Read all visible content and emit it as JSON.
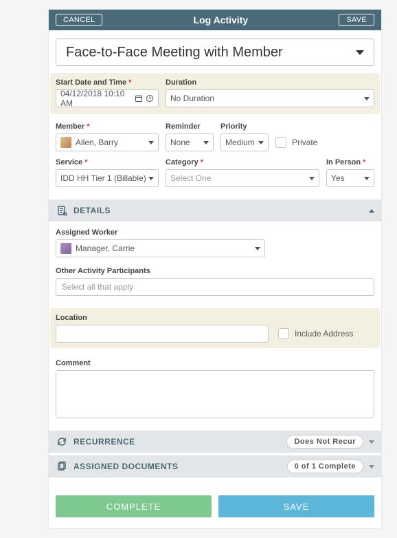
{
  "header": {
    "cancel_label": "CANCEL",
    "title": "Log Activity",
    "save_label": "SAVE"
  },
  "activity_type": {
    "value": "Face-to-Face Meeting with Member"
  },
  "fields": {
    "start": {
      "label": "Start Date and Time",
      "value": "04/12/2018  10:10 AM"
    },
    "duration": {
      "label": "Duration",
      "value": "No Duration"
    },
    "member": {
      "label": "Member",
      "value": "Allen, Barry"
    },
    "reminder": {
      "label": "Reminder",
      "value": "None"
    },
    "priority": {
      "label": "Priority",
      "value": "Medium"
    },
    "private": {
      "label": "Private"
    },
    "service": {
      "label": "Service",
      "value": "IDD HH Tier 1 (Billable)"
    },
    "category": {
      "label": "Category",
      "value": "Select One"
    },
    "inperson": {
      "label": "In Person",
      "value": "Yes"
    }
  },
  "details": {
    "title": "DETAILS",
    "assigned_worker": {
      "label": "Assigned Worker",
      "value": "Manager, Carrie"
    },
    "participants": {
      "label": "Other Activity Participants",
      "placeholder": "Select all that apply"
    },
    "location": {
      "label": "Location",
      "include_addr": "Include Address"
    },
    "comment": {
      "label": "Comment"
    }
  },
  "recurrence": {
    "title": "RECURRENCE",
    "badge": "Does Not Recur"
  },
  "assigned_docs": {
    "title": "ASSIGNED DOCUMENTS",
    "badge_parts": {
      "a": "0",
      "b": " of ",
      "c": "1",
      "d": "  Complete"
    }
  },
  "footer": {
    "complete": "COMPLETE",
    "save": "SAVE"
  }
}
